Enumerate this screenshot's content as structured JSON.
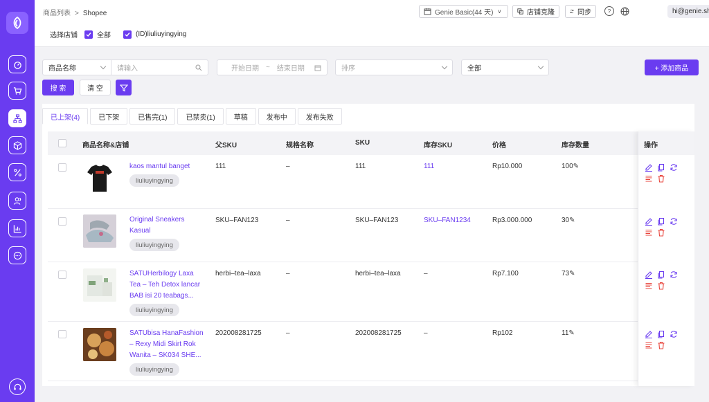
{
  "breadcrumb": {
    "parent": "商品列表",
    "separator": ">",
    "current": "Shopee"
  },
  "store_select": {
    "label": "选择店铺",
    "all_label": "全部",
    "store_label": "(ID)liuliuyingying"
  },
  "toolbar": {
    "plan": "Genie Basic(44 天)",
    "clone_label": "店铺克隆",
    "sync_label": "同步",
    "help": "?",
    "email": "hi@genie.sho..."
  },
  "filters": {
    "field_select": "商品名称",
    "search_placeholder": "请输入",
    "start_date_placeholder": "开始日期",
    "date_separator": "~",
    "end_date_placeholder": "结束日期",
    "sort_placeholder": "排序",
    "status_select": "全部",
    "add_product_label": "+ 添加商品",
    "search_button": "搜 索",
    "clear_button": "清 空"
  },
  "tabs": [
    "已上架(4)",
    "已下架",
    "已售完(1)",
    "已禁卖(1)",
    "草稿",
    "发布中",
    "发布失败"
  ],
  "columns": {
    "product": "商品名称&店铺",
    "parent_sku": "父SKU",
    "spec": "规格名称",
    "sku": "SKU",
    "stock_sku": "库存SKU",
    "price": "价格",
    "stock": "库存数量",
    "ops": "操作"
  },
  "rows": [
    {
      "name_lines": [
        "kaos mantul banget"
      ],
      "store": "liuliuyingying",
      "parent_sku": "111",
      "spec": "–",
      "sku": "111",
      "stock_sku": "111",
      "price": "Rp10.000",
      "stock": "100"
    },
    {
      "name_lines": [
        "Original Sneakers",
        "Kasual"
      ],
      "store": "liuliuyingying",
      "parent_sku": "SKU–FAN123",
      "spec": "–",
      "sku": "SKU–FAN123",
      "stock_sku": "SKU–FAN1234",
      "price": "Rp3.000.000",
      "stock": "30"
    },
    {
      "name_lines": [
        "SATUHerbilogy Laxa",
        "Tea – Teh Detox lancar",
        "BAB isi 20 teabags..."
      ],
      "store": "liuliuyingying",
      "parent_sku": "herbi–tea–laxa",
      "spec": "–",
      "sku": "herbi–tea–laxa",
      "stock_sku": "–",
      "price": "Rp7.100",
      "stock": "73"
    },
    {
      "name_lines": [
        "SATUbisa HanaFashion",
        "– Rexy Midi Skirt Rok",
        "Wanita – SK034 SHE..."
      ],
      "store": "liuliuyingying",
      "parent_sku": "202008281725",
      "spec": "–",
      "sku": "202008281725",
      "stock_sku": "–",
      "price": "Rp102",
      "stock": "11"
    }
  ],
  "colors": {
    "accent": "#6a3cf0",
    "danger": "#e8453c",
    "sidebar": "#6a3cf0"
  },
  "sidebar_icons": [
    "dashboard-icon",
    "cart-icon",
    "product-tree-icon",
    "package-icon",
    "percent-icon",
    "users-icon",
    "chart-icon",
    "chat-icon",
    "headset-icon"
  ]
}
